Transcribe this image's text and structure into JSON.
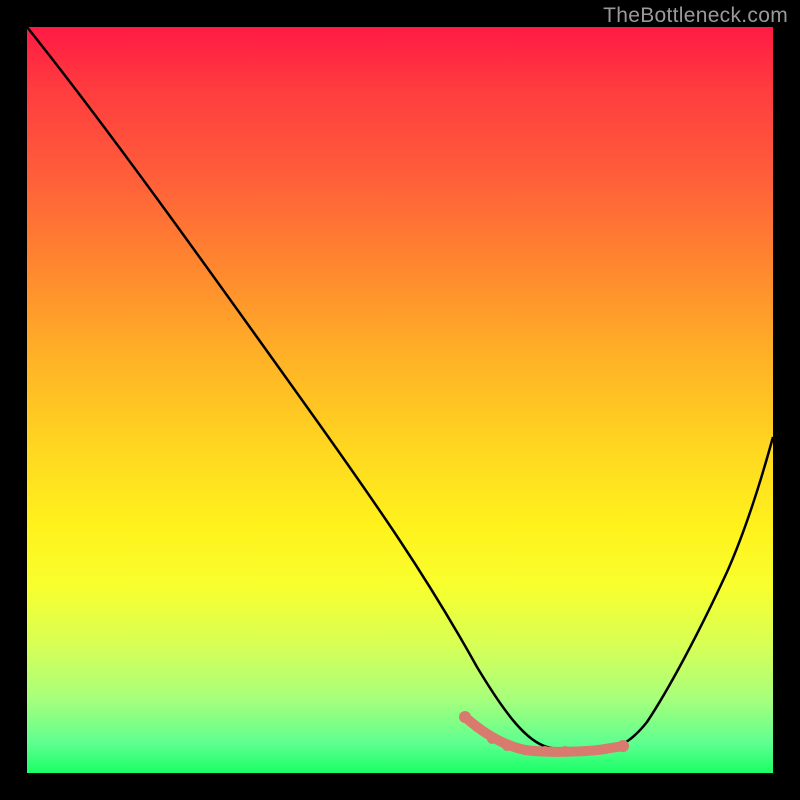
{
  "watermark": "TheBottleneck.com",
  "chart_data": {
    "type": "line",
    "title": "",
    "xlabel": "",
    "ylabel": "",
    "xlim": [
      0,
      100
    ],
    "ylim": [
      0,
      100
    ],
    "series": [
      {
        "name": "bottleneck-curve",
        "x": [
          0,
          5,
          10,
          15,
          20,
          25,
          30,
          35,
          40,
          45,
          50,
          55,
          57,
          60,
          63,
          66,
          70,
          73,
          75,
          78,
          80,
          83,
          86,
          90,
          93,
          97,
          100
        ],
        "y": [
          100,
          94,
          88,
          81,
          74,
          67,
          60,
          53,
          46,
          39,
          32,
          24,
          20,
          15,
          10,
          6,
          4,
          3,
          3,
          3,
          5,
          9,
          15,
          23,
          31,
          42,
          50
        ]
      },
      {
        "name": "optimal-range-marker",
        "x": [
          57,
          60,
          63,
          66,
          70,
          73,
          75,
          78
        ],
        "y": [
          4,
          3.5,
          3,
          3,
          3,
          3,
          3.5,
          4
        ]
      }
    ],
    "background_gradient": {
      "top": "#ff1a44",
      "mid_upper": "#ff8a2e",
      "mid": "#ffe020",
      "mid_lower": "#d6ff56",
      "bottom": "#1aff66"
    },
    "marker_color": "#d97a6f"
  }
}
